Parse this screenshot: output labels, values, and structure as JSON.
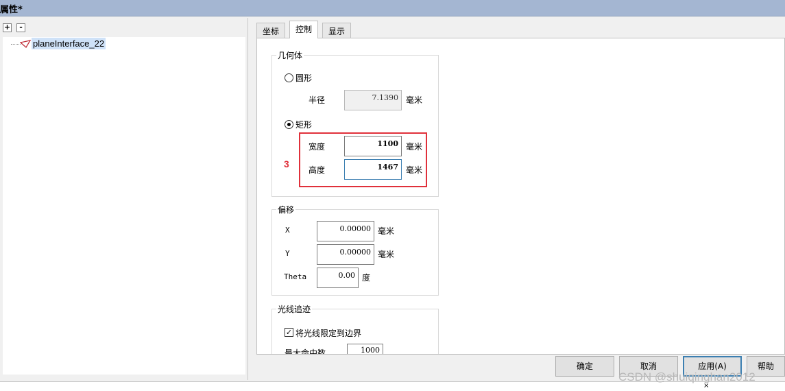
{
  "window": {
    "title": "属性*"
  },
  "tree": {
    "expand_label": "+",
    "collapse_label": "-",
    "item_label": "planeInterface_22"
  },
  "tabs": [
    {
      "label": "坐标"
    },
    {
      "label": "控制"
    },
    {
      "label": "显示"
    }
  ],
  "geometry": {
    "title": "几何体",
    "circle_label": "圆形",
    "radius_label": "半径",
    "radius_value": "7.1390",
    "radius_unit": "毫米",
    "rect_label": "矩形",
    "width_label": "宽度",
    "width_value": "1100",
    "width_unit": "毫米",
    "height_label": "高度",
    "height_value": "1467",
    "height_unit": "毫米",
    "selected_shape": "rectangle"
  },
  "offset": {
    "title": "偏移",
    "x_label": "X",
    "x_value": "0.00000",
    "x_unit": "毫米",
    "y_label": "Y",
    "y_value": "0.00000",
    "y_unit": "毫米",
    "theta_label": "Theta",
    "theta_value": "0.00",
    "theta_unit": "度"
  },
  "ray_trace": {
    "title": "光线追迹",
    "limit_label": "将光线限定到边界",
    "limit_checked": true,
    "max_hits_label": "最大命中数",
    "max_hits_value": "1000"
  },
  "annotation": {
    "marker": "3"
  },
  "buttons": {
    "ok": "确定",
    "cancel": "取消",
    "apply": "应用(A)",
    "help": "帮助"
  },
  "statusbar": {
    "close_glyph": "×"
  },
  "watermark": "CSDN @shuiqinghan2012",
  "colors": {
    "title_bar": "#a4b6d2",
    "highlight": "#e0303a",
    "selection": "#cfe2f8",
    "focus_border": "#3c7fb1"
  }
}
